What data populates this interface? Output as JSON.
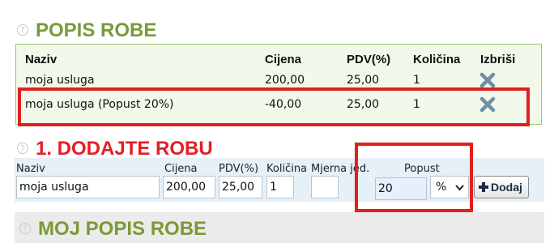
{
  "items_section": {
    "title": "POPIS ROBE",
    "headers": {
      "naziv": "Naziv",
      "cijena": "Cijena",
      "pdv": "PDV(%)",
      "kolicina": "Količina",
      "izbrisi": "Izbriši"
    },
    "rows": [
      {
        "naziv": "moja usluga",
        "cijena": "200,00",
        "pdv": "25,00",
        "kolicina": "1"
      },
      {
        "naziv": "moja usluga (Popust 20%)",
        "cijena": "-40,00",
        "pdv": "25,00",
        "kolicina": "1"
      }
    ]
  },
  "add_section": {
    "title": "1. DODAJTE ROBU",
    "labels": {
      "naziv": "Naziv",
      "cijena": "Cijena",
      "pdv": "PDV(%)",
      "kolicina": "Količina",
      "mjerna": "Mjerna jed.",
      "popust": "Popust"
    },
    "values": {
      "naziv": "moja usluga",
      "cijena": "200,00",
      "pdv": "25,00",
      "kolicina": "1",
      "mjerna": "",
      "popust": "20",
      "popust_unit": "%"
    },
    "add_button": "Dodaj"
  },
  "my_items_section": {
    "title": "MOJ POPIS ROBE"
  },
  "colors": {
    "green_title": "#7a9a35",
    "red_title": "#e31f26",
    "highlight": "#e02020",
    "delete_icon": "#6f8fa6"
  }
}
